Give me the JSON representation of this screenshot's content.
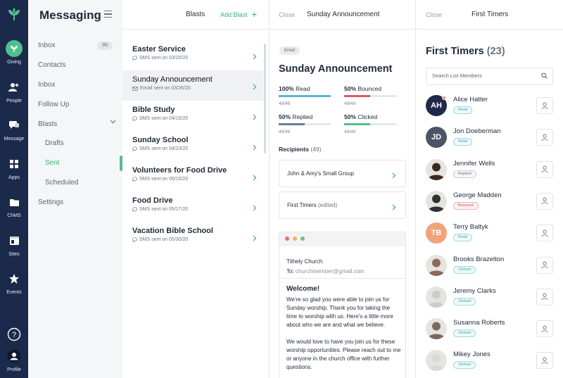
{
  "rail": {
    "items": [
      {
        "label": "Giving",
        "icon": "giving-icon"
      },
      {
        "label": "People",
        "icon": "people-icon"
      },
      {
        "label": "Message",
        "icon": "message-icon"
      },
      {
        "label": "Apps",
        "icon": "apps-icon"
      },
      {
        "label": "ChMS",
        "icon": "folder-icon"
      },
      {
        "label": "Sites",
        "icon": "sites-icon"
      },
      {
        "label": "Events",
        "icon": "star-icon"
      },
      {
        "label": "Help",
        "icon": "help-icon"
      },
      {
        "label": "Profile",
        "icon": "profile-icon"
      }
    ]
  },
  "nav": {
    "title": "Messaging",
    "inbox_label": "Inbox",
    "inbox_count": "99",
    "contacts_label": "Contacts",
    "inbox2_label": "Inbox",
    "follow_up_label": "Follow Up",
    "blasts_label": "Blasts",
    "drafts_label": "Drafts",
    "sent_label": "Sent",
    "scheduled_label": "Scheduled",
    "settings_label": "Settings"
  },
  "blasts": {
    "title": "Blasts",
    "add_label": "Add Blast",
    "items": [
      {
        "title": "Easter Service",
        "sub": "SMS sent on 03/20/20",
        "kind": "sms"
      },
      {
        "title": "Sunday Announcement",
        "sub": "Email sent on 03/26/20",
        "kind": "email"
      },
      {
        "title": "Bible Study",
        "sub": "SMS sent on 04/15/20",
        "kind": "sms"
      },
      {
        "title": "Sunday School",
        "sub": "SMS sent on 04/23/20",
        "kind": "sms"
      },
      {
        "title": "Volunteers for Food Drive",
        "sub": "SMS sent on 05/10/20",
        "kind": "sms"
      },
      {
        "title": "Food Drive",
        "sub": "SMS sent on 05/17/20",
        "kind": "sms"
      },
      {
        "title": "Vacation Bible School",
        "sub": "SMS sent on 05/30/20",
        "kind": "sms"
      }
    ]
  },
  "announcement": {
    "close_label": "Close",
    "header_title": "Sunday Announcement",
    "type_pill": "Email",
    "title": "Sunday Announcement",
    "stats": [
      {
        "pct": "100%",
        "name": "Read",
        "count": "49/49",
        "fraction": 1.0,
        "color": "#5ab4d6"
      },
      {
        "pct": "50%",
        "name": "Bounced",
        "count": "49/49",
        "fraction": 0.5,
        "color": "#e05a5a"
      },
      {
        "pct": "50%",
        "name": "Replied",
        "count": "49/49",
        "fraction": 0.5,
        "color": "#6b7a99"
      },
      {
        "pct": "50%",
        "name": "Clicked",
        "count": "49/49",
        "fraction": 0.5,
        "color": "#4fc08d"
      }
    ],
    "recipients_label": "Recipients",
    "recipients_count": "(49)",
    "recipients": [
      {
        "name": "John & Amy's Small Group",
        "note": ""
      },
      {
        "name": "First Timers",
        "note": "(edited)"
      }
    ],
    "preview": {
      "from": "Tithely Church",
      "to_label": "To:",
      "to_address": "churchmember@gmail.com",
      "greeting": "Welcome!",
      "para1": "We're so glad you were able to join us for Sunday worship. Thank you for taking the time to worship with us. Here's a little more about who we are and what we believe.",
      "para2": "We would love to have you join us for these worship opportunities. Please reach out to me or anyone in the church office with further questions."
    }
  },
  "first_timers": {
    "close_label": "Close",
    "header_title": "First Timers",
    "title": "First Timers",
    "count": "(23)",
    "search_placeholder": "Search List Members",
    "members": [
      {
        "name": "Alice Hatter",
        "status": "Read",
        "status_class": "read",
        "initials": "AH",
        "color": "#1f2a4a"
      },
      {
        "name": "Jon Doeberman",
        "status": "Read",
        "status_class": "read",
        "initials": "JD",
        "color": "#4b5566"
      },
      {
        "name": "Jennifer Wells",
        "status": "Replied",
        "status_class": "replied",
        "initials": "",
        "color": "#3a2a22"
      },
      {
        "name": "George Madden",
        "status": "Bounced",
        "status_class": "bounced",
        "initials": "",
        "color": "#2e3238"
      },
      {
        "name": "Terry Baltyk",
        "status": "Read",
        "status_class": "read",
        "initials": "TB",
        "color": "#f0a37a"
      },
      {
        "name": "Brooks Brazelton",
        "status": "Clicked",
        "status_class": "clicked",
        "initials": "",
        "color": "#8a6a58"
      },
      {
        "name": "Jeremy Clarks",
        "status": "Clicked",
        "status_class": "clicked",
        "initials": "",
        "color": "#c9cdd1"
      },
      {
        "name": "Susanna Roberts",
        "status": "Clicked",
        "status_class": "clicked",
        "initials": "",
        "color": "#7a6a5e"
      },
      {
        "name": "Mikey Jones",
        "status": "Clicked",
        "status_class": "clicked",
        "initials": "",
        "color": "#d8dadd"
      }
    ]
  }
}
